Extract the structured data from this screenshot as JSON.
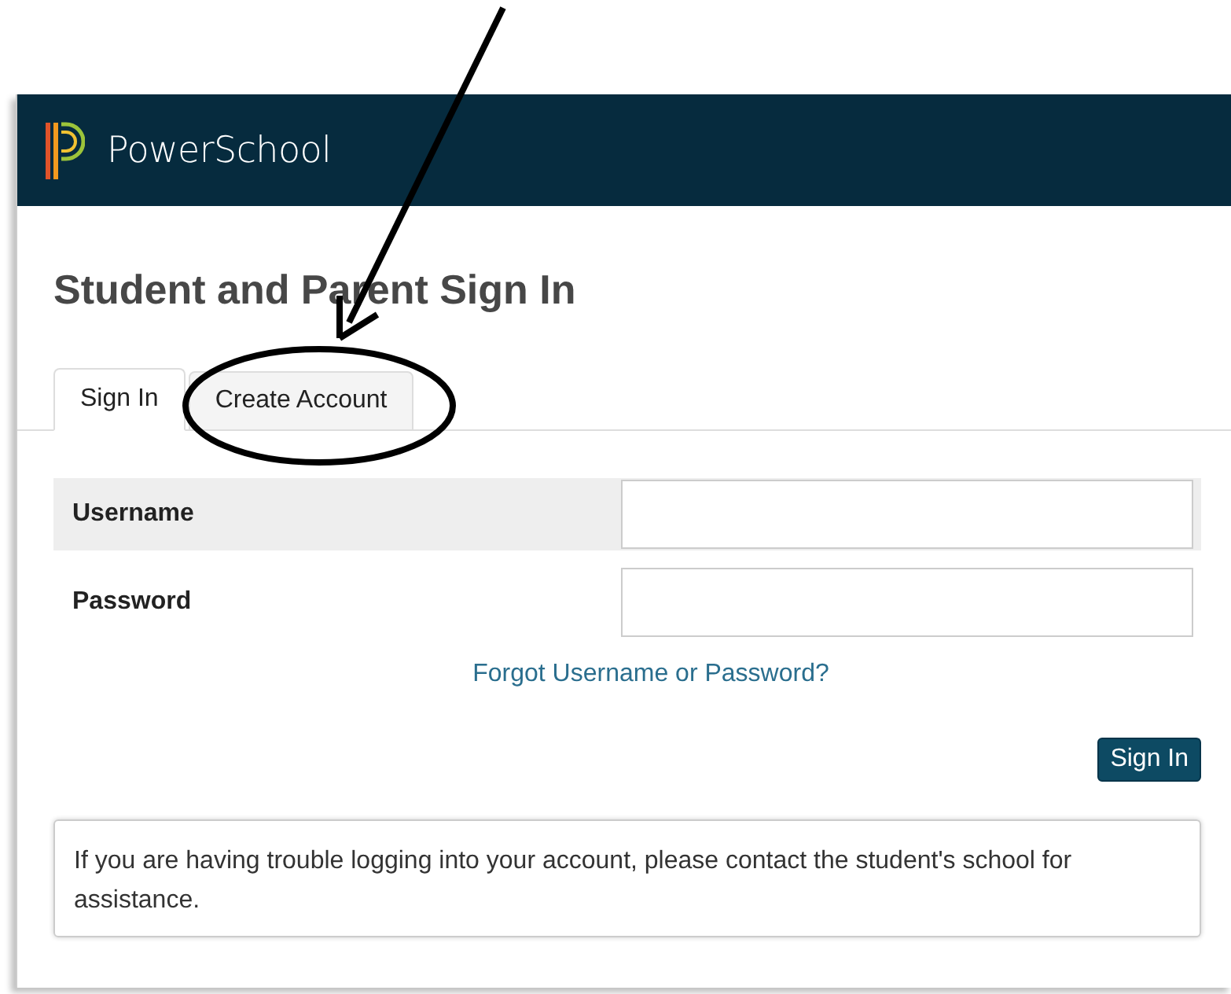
{
  "header": {
    "brand": "PowerSchool"
  },
  "heading": "Student and Parent Sign In",
  "tabs": [
    {
      "label": "Sign In",
      "selected": true
    },
    {
      "label": "Create Account",
      "selected": false
    }
  ],
  "fields": [
    {
      "label": "Username",
      "highlighted": true
    },
    {
      "label": "Password",
      "highlighted": false
    }
  ],
  "forgot_link": "Forgot Username or Password?",
  "submit_button": "Sign In",
  "note": "If you are having trouble logging into your account, please contact the student's school for assistance."
}
